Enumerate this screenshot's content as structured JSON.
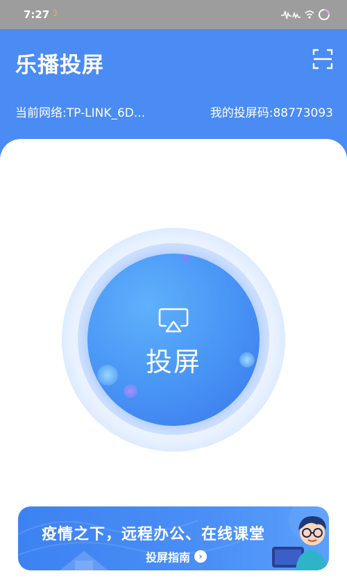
{
  "status_bar": {
    "time": "7:27",
    "icons": [
      "moon-icon",
      "signal-icon",
      "wifi-icon",
      "battery-icon"
    ]
  },
  "header": {
    "title": "乐播投屏",
    "network_text": "当前网络:TP-LINK_6D...",
    "cast_code_text": "我的投屏码:88773093"
  },
  "main": {
    "cast_button_label": "投屏"
  },
  "banner": {
    "headline": "疫情之下，远程办公、在线课堂",
    "guide_label": "投屏指南"
  },
  "colors": {
    "primary": "#4a8bf4",
    "status_bar": "#9d9d9d",
    "card": "#ffffff"
  }
}
